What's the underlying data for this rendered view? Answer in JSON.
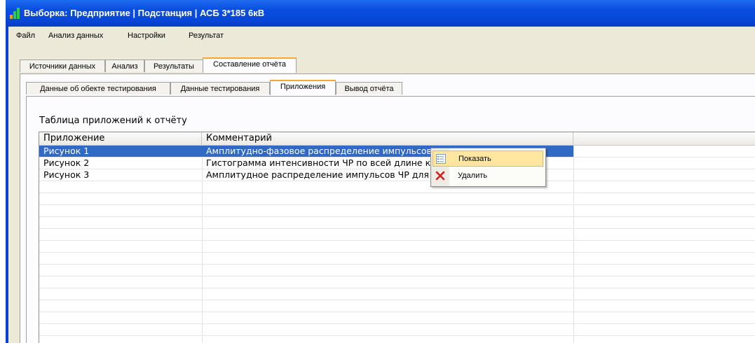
{
  "window": {
    "title": "Выборка: Предприятие | Подстанция | АСБ 3*185 6кВ"
  },
  "menu": [
    "Файл",
    "Анализ данных",
    "Настройки",
    "Результат"
  ],
  "main_tabs": [
    "Источники данных",
    "Анализ",
    "Результаты",
    "Составление отчёта"
  ],
  "main_tab_active": "Составление отчёта",
  "sub_tabs": [
    "Данные об обекте тестирования",
    "Данные тестирования",
    "Приложения",
    "Вывод отчёта"
  ],
  "sub_tab_active": "Приложения",
  "table": {
    "caption": "Таблица приложений к отчёту",
    "columns": [
      "Приложение",
      "Комментарий"
    ],
    "rows": [
      [
        "Рисунок 1",
        "Амплитудно-фазовое распределение импульсов ЧР по всем фазам"
      ],
      [
        "Рисунок 2",
        "Гистограмма интенсивности ЧР по всей длине кабеля"
      ],
      [
        "Рисунок 3",
        "Амплитудное распределение импульсов ЧР для каждой фазы"
      ]
    ],
    "selected_row": 0
  },
  "context_menu": {
    "items": [
      {
        "label": "Показать",
        "icon": "properties-list-icon"
      },
      {
        "label": "Удалить",
        "icon": "delete-x-icon"
      }
    ],
    "highlighted": 0
  },
  "colors": {
    "titlebar": "#0a4fe0",
    "selection": "#316ac5",
    "menu_highlight": "#ffe7a2",
    "active_tab_accent": "#f3a735",
    "delete_icon": "#d81e1e"
  }
}
